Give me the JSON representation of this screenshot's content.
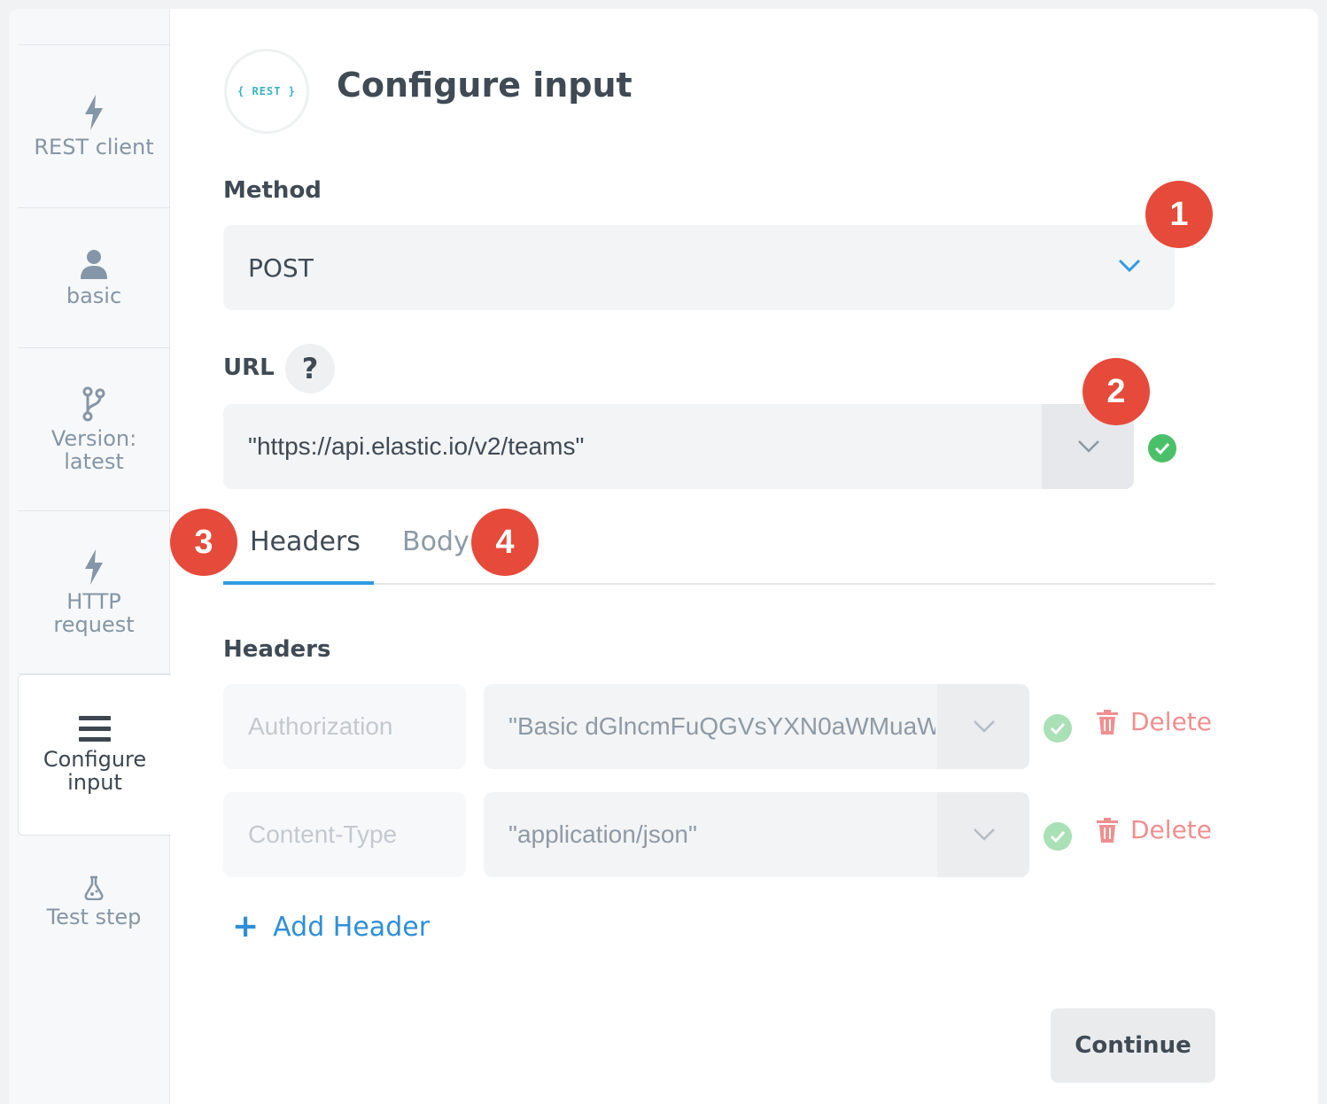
{
  "sidebar": {
    "items": [
      {
        "label": "REST client",
        "icon": "lightning-icon"
      },
      {
        "label": "basic",
        "icon": "user-icon"
      },
      {
        "label": "Version: latest",
        "icon": "branch-icon"
      },
      {
        "label": "HTTP request",
        "icon": "lightning-icon"
      },
      {
        "label": "Configure input",
        "icon": "menu-icon",
        "active": true
      },
      {
        "label": "Test step",
        "icon": "flask-icon"
      }
    ]
  },
  "header": {
    "logo_text": "{ REST }",
    "title": "Configure input"
  },
  "method": {
    "label": "Method",
    "value": "POST"
  },
  "url": {
    "label": "URL",
    "help": "?",
    "value": "\"https://api.elastic.io/v2/teams\""
  },
  "tabs": [
    {
      "label": "Headers",
      "active": true
    },
    {
      "label": "Body",
      "active": false
    }
  ],
  "headers_section": {
    "title": "Headers",
    "rows": [
      {
        "key": "Authorization",
        "value": "\"Basic dGlncmFuQGVsYXN0aWMuaW",
        "delete_label": "Delete"
      },
      {
        "key": "Content-Type",
        "value": "\"application/json\"",
        "delete_label": "Delete"
      }
    ],
    "add_label": "Add Header"
  },
  "continue_label": "Continue",
  "annotations": [
    "1",
    "2",
    "3",
    "4"
  ],
  "colors": {
    "accent": "#2f9be3",
    "success": "#4bc06a",
    "danger": "#f08f8f",
    "badge": "#e64a3a"
  }
}
